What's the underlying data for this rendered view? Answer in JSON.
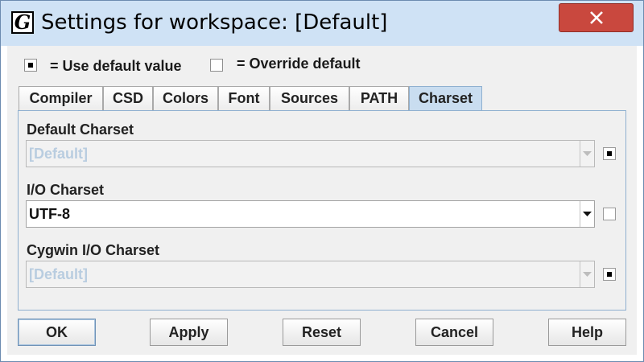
{
  "window": {
    "title": "Settings for workspace: [Default]",
    "app_icon_glyph": "G",
    "close_glyph": "close-icon"
  },
  "legend": {
    "default_label": "= Use default value",
    "override_label": "= Override default"
  },
  "tabs": [
    {
      "label": "Compiler",
      "active": false
    },
    {
      "label": "CSD",
      "active": false
    },
    {
      "label": "Colors",
      "active": false
    },
    {
      "label": "Font",
      "active": false
    },
    {
      "label": "Sources",
      "active": false
    },
    {
      "label": "PATH",
      "active": false
    },
    {
      "label": "Charset",
      "active": true
    }
  ],
  "fields": [
    {
      "label": "Default Charset",
      "value": "[Default]",
      "enabled": false,
      "override": false
    },
    {
      "label": "I/O Charset",
      "value": "UTF-8",
      "enabled": true,
      "override": true
    },
    {
      "label": "Cygwin I/O Charset",
      "value": "[Default]",
      "enabled": false,
      "override": false
    }
  ],
  "buttons": {
    "ok": "OK",
    "apply": "Apply",
    "reset": "Reset",
    "cancel": "Cancel",
    "help": "Help"
  },
  "colors": {
    "titlebar": "#cfe2f5",
    "close_button": "#c9483e",
    "active_tab": "#c9ddf0",
    "disabled_text": "#b9cde0"
  }
}
